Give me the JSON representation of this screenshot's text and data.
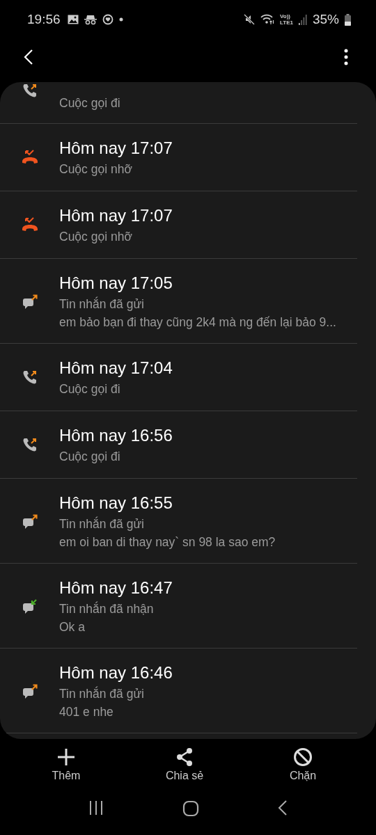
{
  "status_bar": {
    "time": "19:56",
    "network": "Vo))\nLTE1",
    "battery": "35%"
  },
  "entries": [
    {
      "kind": "call_out",
      "subtitle": "Cuộc gọi đi"
    },
    {
      "kind": "call_missed",
      "title": "Hôm nay 17:07",
      "subtitle": "Cuộc gọi nhỡ"
    },
    {
      "kind": "call_missed",
      "title": "Hôm nay 17:07",
      "subtitle": "Cuộc gọi nhỡ"
    },
    {
      "kind": "msg_sent",
      "title": "Hôm nay 17:05",
      "subtitle": "Tin nhắn đã gửi",
      "message": "em bảo bạn đi thay cũng 2k4 mà ng đến lại bảo 9..."
    },
    {
      "kind": "call_out",
      "title": "Hôm nay 17:04",
      "subtitle": "Cuộc gọi đi"
    },
    {
      "kind": "call_out",
      "title": "Hôm nay 16:56",
      "subtitle": "Cuộc gọi đi"
    },
    {
      "kind": "msg_sent",
      "title": "Hôm nay 16:55",
      "subtitle": "Tin nhắn đã gửi",
      "message": "em oi ban di thay nay` sn 98 la sao em?"
    },
    {
      "kind": "msg_received",
      "title": "Hôm nay 16:47",
      "subtitle": "Tin nhắn đã nhận",
      "message": "Ok a"
    },
    {
      "kind": "msg_sent",
      "title": "Hôm nay 16:46",
      "subtitle": "Tin nhắn đã gửi",
      "message": "401 e nhe"
    }
  ],
  "actions": [
    {
      "kind": "add",
      "label": "Thêm"
    },
    {
      "kind": "share",
      "label": "Chia sẻ"
    },
    {
      "kind": "block",
      "label": "Chặn"
    }
  ]
}
